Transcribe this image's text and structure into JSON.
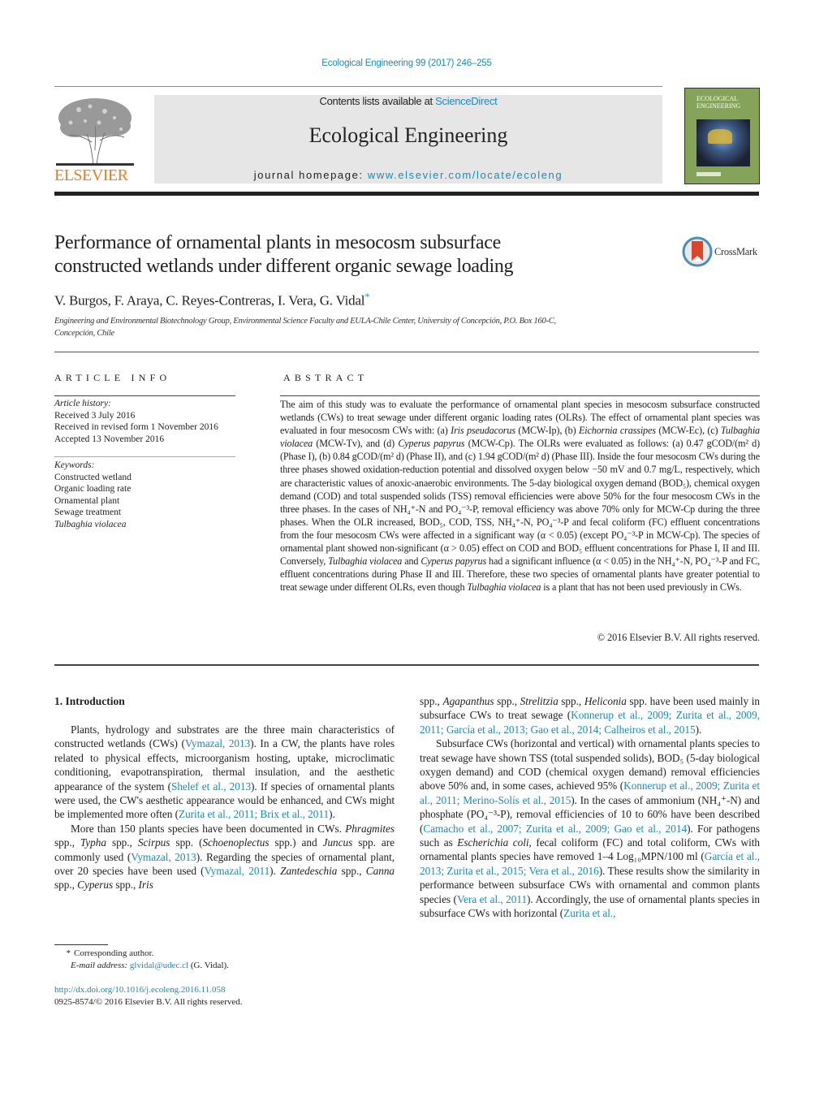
{
  "header": {
    "journal_ref": "Ecological Engineering 99 (2017) 246–255",
    "contents_prefix": "Contents lists available at ",
    "contents_link": "ScienceDirect",
    "journal_title": "Ecological Engineering",
    "homepage_prefix": "journal homepage: ",
    "homepage_link": "www.elsevier.com/locate/ecoleng",
    "publisher_logo": "ELSEVIER",
    "cover_title_line1": "ECOLOGICAL",
    "cover_title_line2": "ENGINEERING",
    "colors": {
      "link": "#1b8ab8",
      "elsevier_orange": "#f07d1a",
      "masthead_bg": "#e6e6e6",
      "cover_green": "#86a35a"
    }
  },
  "article": {
    "title_line1": "Performance of ornamental plants in mesocosm subsurface",
    "title_line2": "constructed wetlands under different organic sewage loading",
    "crossmark_label": "CrossMark",
    "authors": "V. Burgos, F. Araya, C. Reyes-Contreras, I. Vera, G. Vidal",
    "author_mark": "*",
    "affiliation_line1": "Engineering and Environmental Biotechnology Group, Environmental Science Faculty and EULA-Chile Center, University of Concepción, P.O. Box 160-C,",
    "affiliation_line2": "Concepción, Chile"
  },
  "article_info": {
    "heading": "ARTICLE INFO",
    "history_label": "Article history:",
    "history": [
      "Received 3 July 2016",
      "Received in revised form 1 November 2016",
      "Accepted 13 November 2016"
    ],
    "keywords_label": "Keywords:",
    "keywords": [
      "Constructed wetland",
      "Organic loading rate",
      "Ornamental plant",
      "Sewage treatment",
      "Tulbaghia violacea"
    ]
  },
  "abstract": {
    "heading": "ABSTRACT",
    "segments": [
      "The aim of this study was to evaluate the performance of ornamental plant species in mesocosm subsurface constructed wetlands (CWs) to treat sewage under different organic loading rates (OLRs). The effect of ornamental plant species was evaluated in four mesocosm CWs with: (a) ",
      "Iris pseudacorus",
      " (MCW-Ip), (b) ",
      "Eichornia crassipes",
      " (MCW-Ec), (c) ",
      "Tulbaghia violacea",
      " (MCW-Tv), and (d) ",
      "Cyperus papyrus",
      " (MCW-Cp). The OLRs were evaluated as follows: (a) 0.47 gCOD/(m² d) (Phase I), (b) 0.84 gCOD/(m² d) (Phase II), and (c) 1.94 gCOD/(m² d) (Phase III). Inside the four mesocosm CWs during the three phases showed oxidation-reduction potential and dissolved oxygen below −50 mV and 0.7 mg/L, respectively, which are characteristic values of anoxic-anaerobic environments. The 5-day biological oxygen demand (BOD₅), chemical oxygen demand (COD) and total suspended solids (TSS) removal efficiencies were above 50% for the four mesocosm CWs in the three phases. In the cases of NH₄⁺-N and PO₄⁻³-P, removal efficiency was above 70% only for MCW-Cp during the three phases. When the OLR increased, BOD₅, COD, TSS, NH₄⁺-N, PO₄⁻³-P and fecal coliform (FC) effluent concentrations from the four mesocosm CWs were affected in a significant way (α < 0.05) (except PO₄⁻³-P in MCW-Cp). The species of ornamental plant showed non-significant (α > 0.05) effect on COD and BOD₅ effluent concentrations for Phase I, II and III. Conversely, ",
      "Tulbaghia violacea",
      " and ",
      "Cyperus papyrus",
      " had a significant influence (α < 0.05) in the NH₄⁺-N, PO₄⁻³-P and FC, effluent concentrations during Phase II and III. Therefore, these two species of ornamental plants have greater potential to treat sewage under different OLRs, even though ",
      "Tulbaghia violacea",
      " is a plant that has not been used previously in CWs."
    ],
    "copyright": "© 2016 Elsevier B.V. All rights reserved."
  },
  "introduction": {
    "heading": "1.  Introduction",
    "left_p1": [
      "Plants, hydrology and substrates are the three main characteristics of constructed wetlands (CWs) (",
      "Vymazal, 2013",
      "). In a CW, the plants have roles related to physical effects, microorganism hosting, uptake, microclimatic conditioning, evapotranspiration, thermal insulation, and the aesthetic appearance of the system (",
      "Shelef et al., 2013",
      "). If species of ornamental plants were used, the CW's aesthetic appearance would be enhanced, and CWs might be implemented more often (",
      "Zurita et al., 2011; Brix et al., 2011",
      ")."
    ],
    "left_p2": [
      "More than 150 plants species have been documented in CWs. ",
      "Phragmites",
      " spp., ",
      "Typha",
      " spp., ",
      "Scirpus",
      " spp. (",
      "Schoenoplectus",
      " spp.) and ",
      "Juncus",
      " spp. are commonly used (",
      "Vymazal, 2013",
      "). Regarding the species of ornamental plant, over 20 species have been used (",
      "Vymazal, 2011",
      "). ",
      "Zantedeschia",
      " spp., ",
      "Canna",
      " spp., ",
      "Cyperus",
      " spp., ",
      "Iris"
    ],
    "right_p1": [
      "spp., ",
      "Agapanthus",
      " spp., ",
      "Strelitzia",
      " spp., ",
      "Heliconia",
      " spp. have been used mainly in subsurface CWs to treat sewage (",
      "Konnerup et al., 2009; Zurita et al., 2009, 2011; García et al., 2013; Gao et al., 2014; Calheiros et al., 2015",
      ")."
    ],
    "right_p2": [
      "Subsurface CWs (horizontal and vertical) with ornamental plants species to treat sewage have shown TSS (total suspended solids), BOD₅ (5-day biological oxygen demand) and COD (chemical oxygen demand) removal efficiencies above 50% and, in some cases, achieved 95% (",
      "Konnerup et al., 2009; Zurita et al., 2011; Merino-Solís et al., 2015",
      "). In the cases of ammonium (NH₄⁺-N) and phosphate (PO₄⁻³-P), removal efficiencies of 10 to 60% have been described (",
      "Camacho et al., 2007; Zurita et al., 2009; Gao et al., 2014",
      "). For pathogens such as ",
      "Escherichia coli",
      ", fecal coliform (FC) and total coliform, CWs with ornamental plants species have removed 1–4 Log₁₀MPN/100 ml (",
      "García et al., 2013; Zurita et al., 2015; Vera et al., 2016",
      "). These results show the similarity in performance between subsurface CWs with ornamental and common plants species (",
      "Vera et al., 2011",
      "). Accordingly, the use of ornamental plants species in subsurface CWs with horizontal (",
      "Zurita et al.,"
    ]
  },
  "footnote": {
    "star": "*",
    "corresponding": "Corresponding author.",
    "email_label": "E-mail address: ",
    "email": "glvidal@udec.cl",
    "email_suffix": " (G. Vidal).",
    "doi": "http://dx.doi.org/10.1016/j.ecoleng.2016.11.058",
    "issn_line": "0925-8574/© 2016 Elsevier B.V. All rights reserved."
  }
}
